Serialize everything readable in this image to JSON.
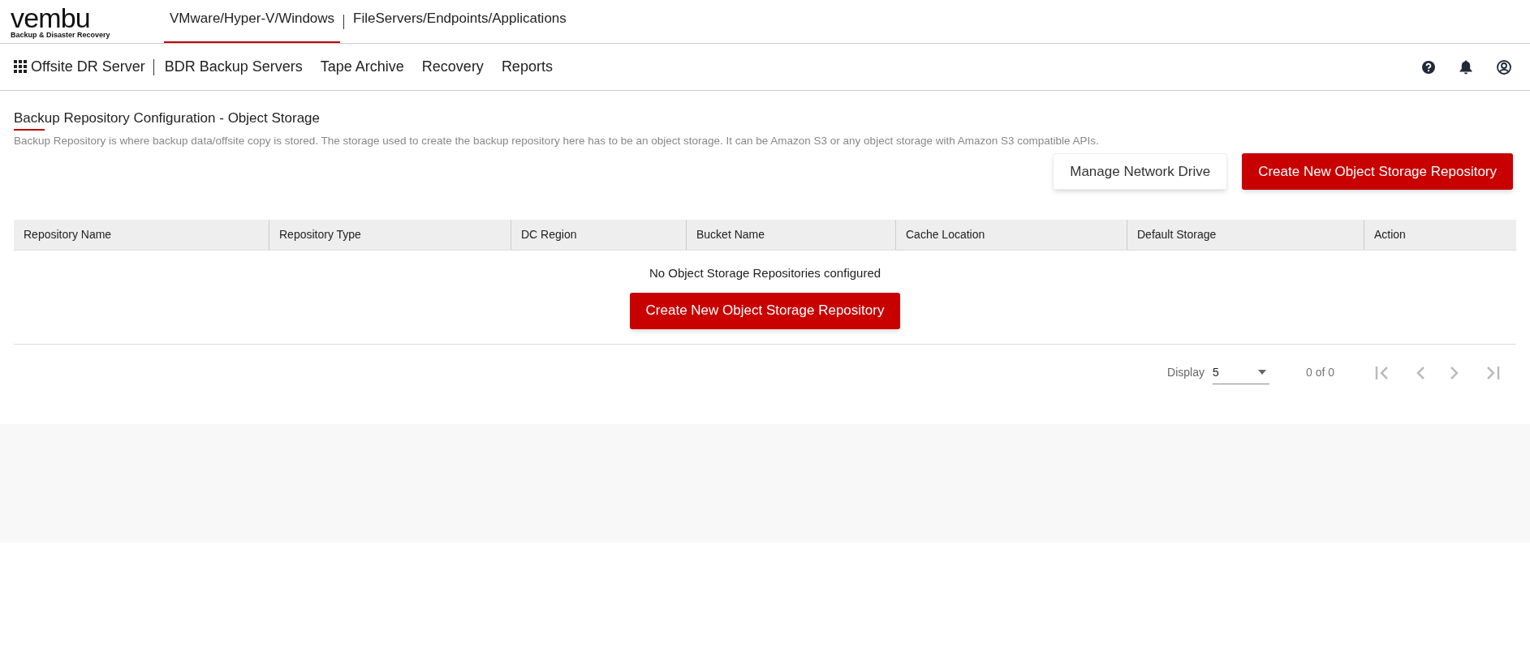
{
  "logo": {
    "wordmark": "vembu",
    "tagline": "Backup & Disaster Recovery"
  },
  "top_tabs": [
    {
      "label": "VMware/Hyper-V/Windows",
      "selected": true
    },
    {
      "label": "FileServers/Endpoints/Applications",
      "selected": false
    }
  ],
  "nav": {
    "app_title": "Offsite DR Server",
    "items": [
      "BDR Backup Servers",
      "Tape Archive",
      "Recovery",
      "Reports"
    ]
  },
  "page": {
    "title": "Backup Repository Configuration - Object Storage",
    "description": "Backup Repository is where backup data/offsite copy is stored. The storage used to create the backup repository here has to be an object storage. It can be Amazon S3 or any object storage with Amazon S3 compatible APIs.",
    "buttons": [
      {
        "label": "Manage Network Drive",
        "kind": "secondary"
      },
      {
        "label": "Create New Object Storage Repository",
        "kind": "primary"
      }
    ]
  },
  "table": {
    "columns": [
      "Repository Name",
      "Repository Type",
      "DC Region",
      "Bucket Name",
      "Cache Location",
      "Default Storage",
      "Action"
    ],
    "empty_message": "No Object Storage Repositories configured",
    "empty_button": "Create New Object Storage Repository"
  },
  "pagination": {
    "display_label": "Display",
    "page_size": "5",
    "range": "0 of 0"
  }
}
